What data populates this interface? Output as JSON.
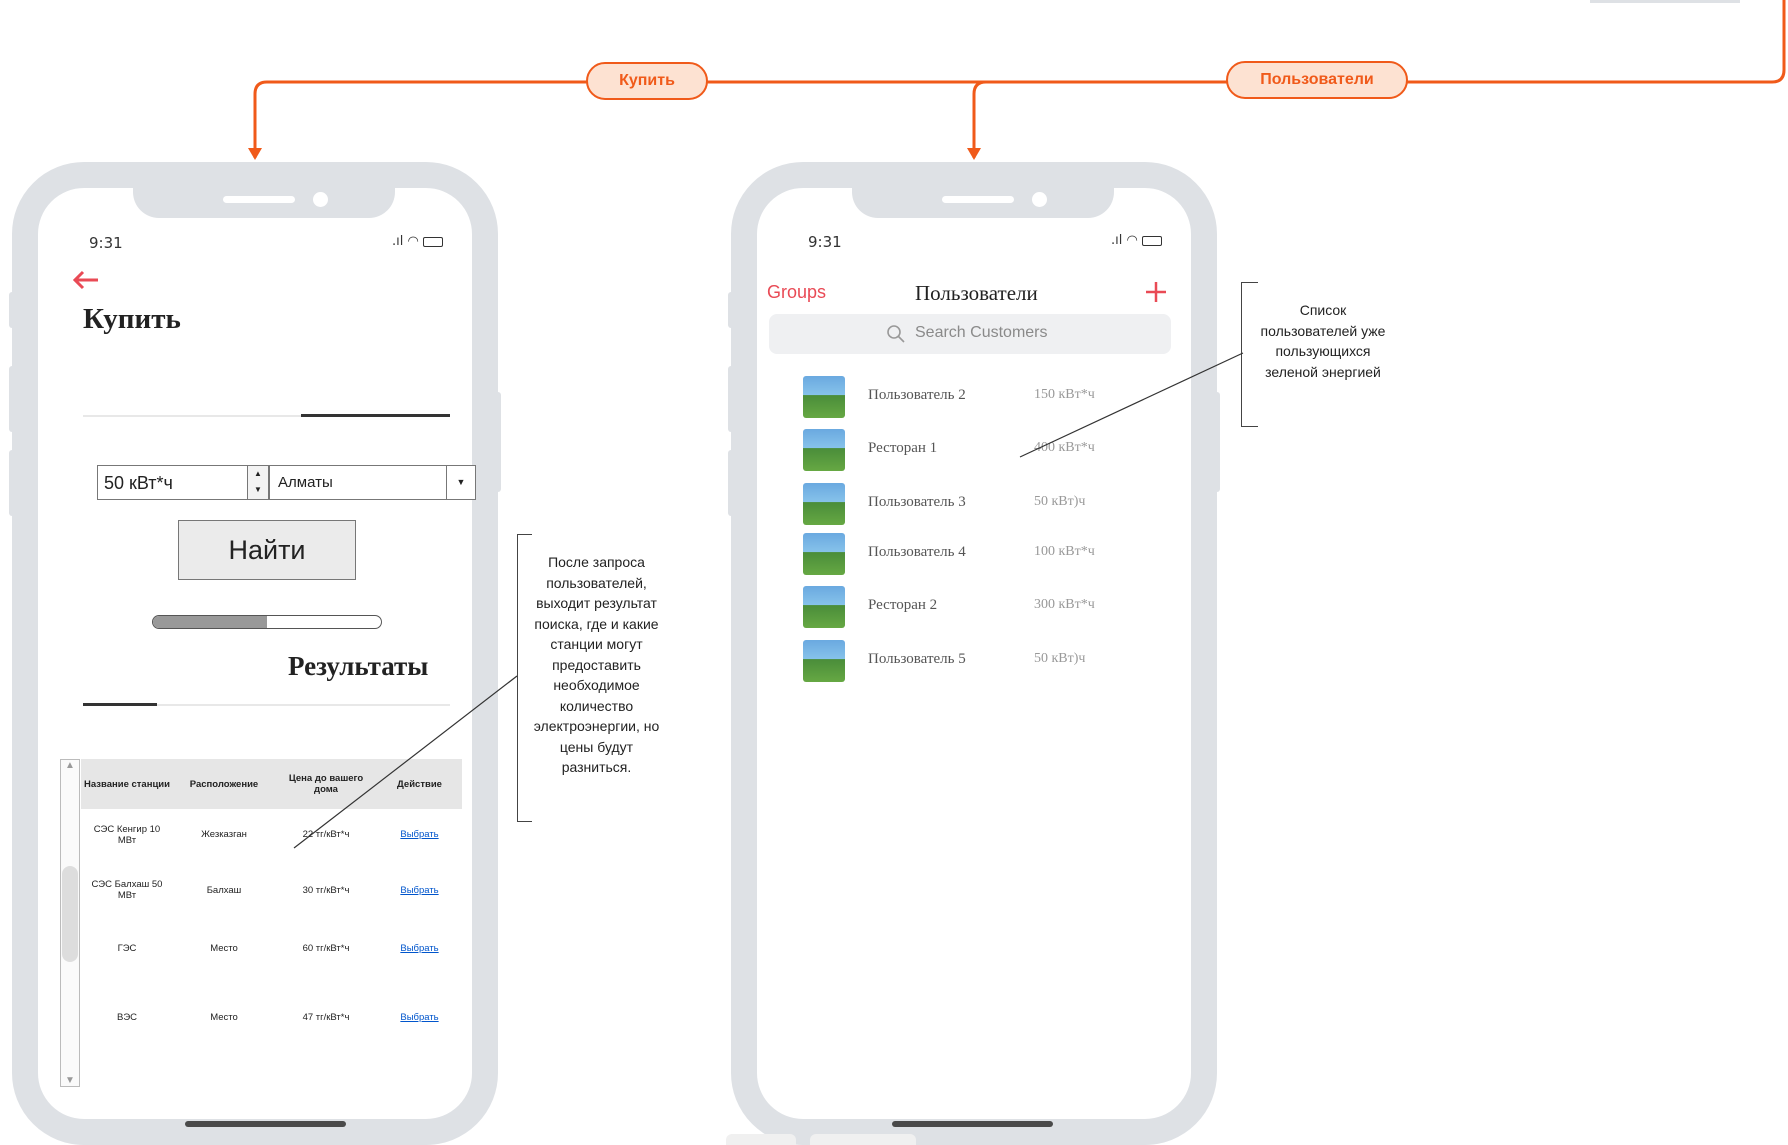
{
  "flow": {
    "buy_label": "Купить",
    "users_label": "Пользователи",
    "accent": "#f05a1a"
  },
  "buy_screen": {
    "time": "9:31",
    "back_icon": "arrow-left-icon",
    "title": "Купить",
    "amount_value": "50 кВт*ч",
    "city_value": "Алматы",
    "search_button": "Найти",
    "progress": 0.5,
    "results_title": "Результаты",
    "table": {
      "headers": [
        "Название станции",
        "Расположение",
        "Цена до вашего дома",
        "Действие"
      ],
      "rows": [
        [
          "СЭС Кенгир 10 МВт",
          "Жезказган",
          "22 тг/кВт*ч",
          "Выбрать"
        ],
        [
          "СЭС Балхаш 50 МВт",
          "Балхаш",
          "30 тг/кВт*ч",
          "Выбрать"
        ],
        [
          "ГЭС",
          "Место",
          "60 тг/кВт*ч",
          "Выбрать"
        ],
        [
          "ВЭС",
          "Место",
          "47 тг/кВт*ч",
          "Выбрать"
        ]
      ]
    },
    "note": "После запроса пользователей, выходит результат поиска, где и какие станции могут предоставить необходимое количество электроэнергии, но цены будут разниться."
  },
  "users_screen": {
    "time": "9:31",
    "groups_link": "Groups",
    "title": "Пользователи",
    "add_icon": "plus-icon",
    "search_placeholder": "Search Customers",
    "users": [
      {
        "name": "Пользователь 2",
        "value": "150 кВт*ч"
      },
      {
        "name": "Ресторан 1",
        "value": "400 кВт*ч"
      },
      {
        "name": "Пользователь 3",
        "value": "50 кВт)ч"
      },
      {
        "name": "Пользователь 4",
        "value": "100 кВт*ч"
      },
      {
        "name": "Ресторан 2",
        "value": "300 кВт*ч"
      },
      {
        "name": "Пользователь 5",
        "value": "50 кВт)ч"
      }
    ],
    "note": "Список пользователей уже пользующихся зеленой энергией"
  },
  "colors": {
    "red_accent": "#e94a55",
    "phone_frame": "#dee1e5",
    "link_blue": "#0055cc"
  }
}
